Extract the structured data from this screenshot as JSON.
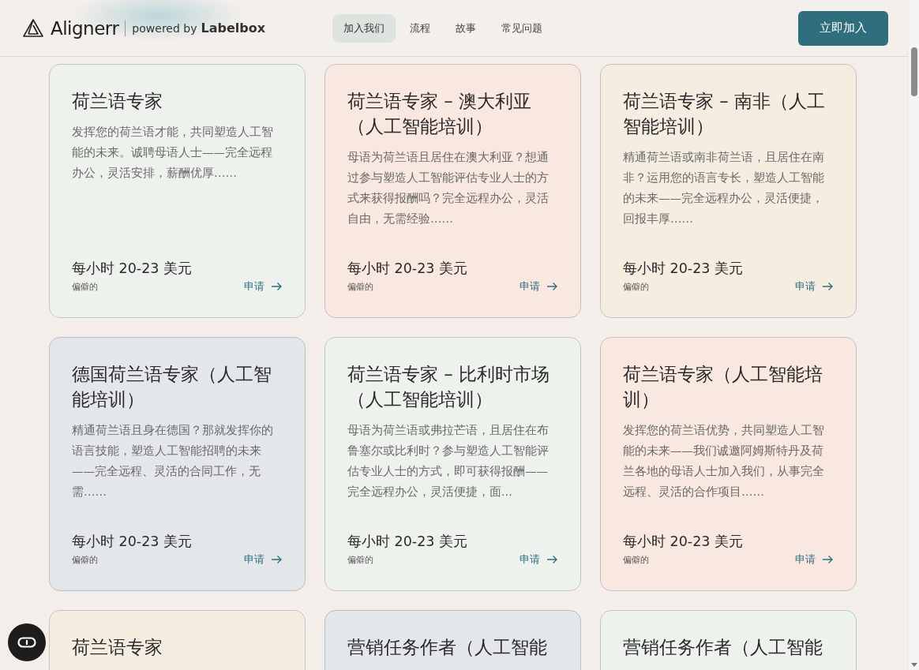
{
  "header": {
    "brand": "Alignerr",
    "powered_by": "powered by",
    "partner": "Labelbox",
    "nav": [
      {
        "label": "加入我们",
        "selected": true
      },
      {
        "label": "流程",
        "selected": false
      },
      {
        "label": "故事",
        "selected": false
      },
      {
        "label": "常见问题",
        "selected": false
      }
    ],
    "cta": "立即加入"
  },
  "jobs": [
    {
      "title": "荷兰语专家",
      "description": "发挥您的荷兰语才能，共同塑造人工智能的未来。诚聘母语人士——完全远程办公，灵活安排，薪酬优厚……",
      "pay": "每小时 20-23 美元",
      "location": "偏僻的",
      "apply": "申请",
      "color": "#eef2ec"
    },
    {
      "title": "荷兰语专家 – 澳大利亚（人工智能培训）",
      "description": "母语为荷兰语且居住在澳大利亚？想通过参与塑造人工智能评估专业人士的方式来获得报酬吗？完全远程办公，灵活自由，无需经验……",
      "pay": "每小时 20-23 美元",
      "location": "偏僻的",
      "apply": "申请",
      "color": "#f8e8df"
    },
    {
      "title": "荷兰语专家 – 南非（人工智能培训）",
      "description": "精通荷兰语或南非荷兰语，且居住在南非？运用您的语言专长，塑造人工智能的未来——完全远程办公，灵活便捷，回报丰厚……",
      "pay": "每小时 20-23 美元",
      "location": "偏僻的",
      "apply": "申请",
      "color": "#f5ede0"
    },
    {
      "title": "德国荷兰语专家（人工智能培训）",
      "description": "精通荷兰语且身在德国？那就发挥你的语言技能，塑造人工智能招聘的未来——完全远程、灵活的合同工作，无需……",
      "pay": "每小时 20-23 美元",
      "location": "偏僻的",
      "apply": "申请",
      "color": "#e4e7ea"
    },
    {
      "title": "荷兰语专家 – 比利时市场（人工智能培训）",
      "description": "母语为荷兰语或弗拉芒语，且居住在布鲁塞尔或比利时？参与塑造人工智能评估专业人士的方式，即可获得报酬——完全远程办公，灵活便捷，面...",
      "pay": "每小时 20-23 美元",
      "location": "偏僻的",
      "apply": "申请",
      "color": "#eef2ec"
    },
    {
      "title": "荷兰语专家（人工智能培训）",
      "description": "发挥您的荷兰语优势，共同塑造人工智能的未来——我们诚邀阿姆斯特丹及荷兰各地的母语人士加入我们，从事完全远程、灵活的合作项目……",
      "pay": "每小时 20-23 美元",
      "location": "偏僻的",
      "apply": "申请",
      "color": "#f8e8df"
    },
    {
      "title": "荷兰语专家",
      "color": "#f5ede0"
    },
    {
      "title": "营销任务作者（人工智能",
      "color": "#e4e7ea"
    },
    {
      "title": "营销任务作者（人工智能",
      "color": "#eef2ec"
    }
  ]
}
